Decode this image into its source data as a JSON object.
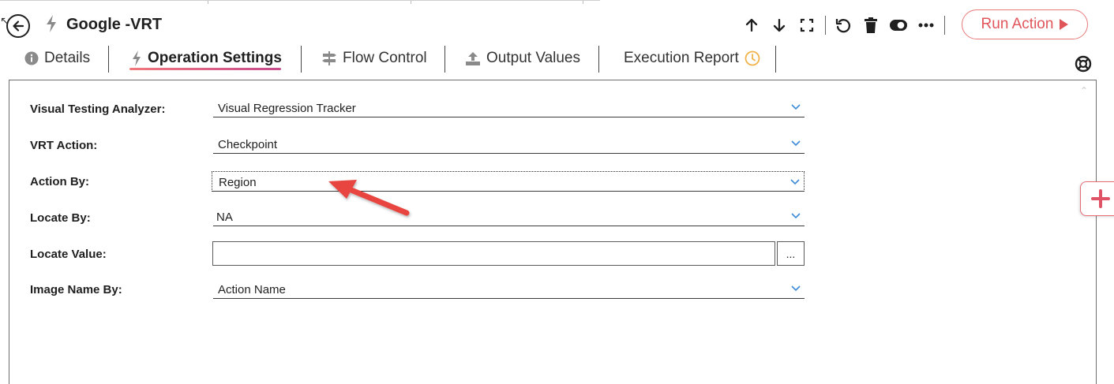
{
  "header": {
    "title": "Google -VRT",
    "run_action_label": "Run Action"
  },
  "tabs": [
    {
      "label": "Details",
      "icon": "info-circle-icon"
    },
    {
      "label": "Operation Settings",
      "icon": "bolt-icon",
      "active": true
    },
    {
      "label": "Flow Control",
      "icon": "signpost-icon"
    },
    {
      "label": "Output Values",
      "icon": "upload-icon"
    },
    {
      "label": "Execution Report",
      "icon": "clock-icon"
    }
  ],
  "form": {
    "visual_testing_analyzer": {
      "label": "Visual Testing Analyzer:",
      "value": "Visual Regression Tracker"
    },
    "vrt_action": {
      "label": "VRT Action:",
      "value": "Checkpoint"
    },
    "action_by": {
      "label": "Action By:",
      "value": "Region"
    },
    "locate_by": {
      "label": "Locate By:",
      "value": "NA"
    },
    "locate_value": {
      "label": "Locate Value:",
      "value": "",
      "browse_label": "..."
    },
    "image_name_by": {
      "label": "Image Name By:",
      "value": "Action Name"
    }
  },
  "colors": {
    "accent": "#e0555a",
    "tab_underline_start": "#f0787a",
    "tab_underline_end": "#c64b8f",
    "chevron": "#3c8ad8",
    "clock": "#f2b24a",
    "annotation_arrow": "#e8443f"
  }
}
